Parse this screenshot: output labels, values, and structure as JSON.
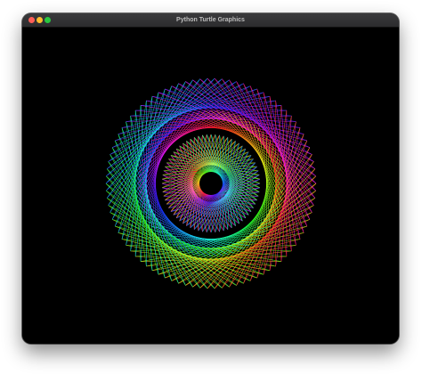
{
  "window": {
    "title": "Python Turtle Graphics"
  },
  "traffic_lights": {
    "close_color": "#ff5f57",
    "minimize_color": "#febc2e",
    "maximize_color": "#28c840"
  },
  "canvas": {
    "background": "#000000",
    "drawing": "rainbow-spirograph"
  }
}
